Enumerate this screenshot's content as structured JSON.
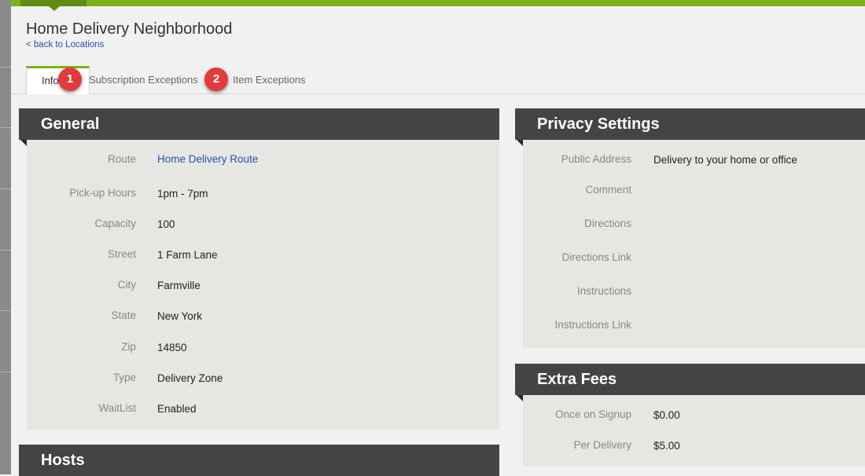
{
  "header": {
    "title": "Home Delivery Neighborhood",
    "back_link": "< back to Locations"
  },
  "tabs": [
    {
      "label": "Info",
      "active": true
    },
    {
      "label": "Subscription Exceptions",
      "active": false
    },
    {
      "label": "Item Exceptions",
      "active": false
    }
  ],
  "markers": [
    "1",
    "2"
  ],
  "general": {
    "title": "General",
    "rows": [
      {
        "label": "Route",
        "value": "Home Delivery Route"
      },
      {
        "label": "Pick-up Hours",
        "value": "1pm - 7pm"
      },
      {
        "label": "Capacity",
        "value": "100"
      },
      {
        "label": "Street",
        "value": "1 Farm Lane"
      },
      {
        "label": "City",
        "value": "Farmville"
      },
      {
        "label": "State",
        "value": "New York"
      },
      {
        "label": "Zip",
        "value": "14850"
      },
      {
        "label": "Type",
        "value": "Delivery Zone"
      },
      {
        "label": "WaitList",
        "value": "Enabled"
      }
    ]
  },
  "hosts": {
    "title": "Hosts"
  },
  "privacy": {
    "title": "Privacy Settings",
    "rows": [
      {
        "label": "Public Address",
        "value": "Delivery to your home or office"
      },
      {
        "label": "Comment",
        "value": ""
      },
      {
        "label": "Directions",
        "value": ""
      },
      {
        "label": "Directions Link",
        "value": ""
      },
      {
        "label": "Instructions",
        "value": ""
      },
      {
        "label": "Instructions Link",
        "value": ""
      }
    ]
  },
  "fees": {
    "title": "Extra Fees",
    "rows": [
      {
        "label": "Once on Signup",
        "value": "$0.00"
      },
      {
        "label": "Per Delivery",
        "value": "$5.00"
      }
    ]
  },
  "colors": {
    "accent": "#7ab317",
    "panel_header": "#444444",
    "panel_body": "#e6e6e2",
    "link": "#2a4fb4",
    "marker": "#e23b3b"
  }
}
